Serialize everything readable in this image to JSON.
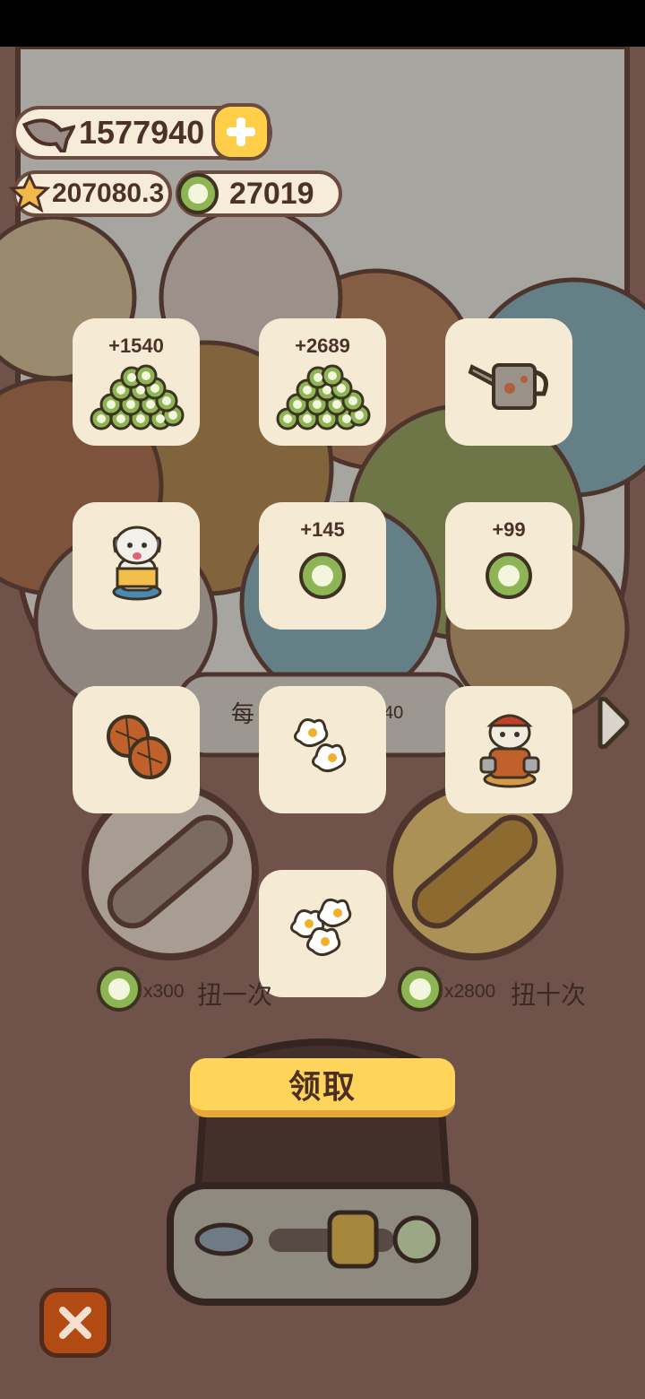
{
  "currency": {
    "fish": "1577940",
    "stars": "207080.3",
    "coins": "27019"
  },
  "rewards": [
    {
      "amount": "+1540",
      "item": "coin-pile"
    },
    {
      "amount": "+2689",
      "item": "coin-pile"
    },
    {
      "amount": "",
      "item": "watering-can"
    },
    {
      "amount": "",
      "item": "dog-reading"
    },
    {
      "amount": "+145",
      "item": "coin"
    },
    {
      "amount": "+99",
      "item": "coin"
    },
    {
      "amount": "",
      "item": "brown-balls"
    },
    {
      "amount": "",
      "item": "fried-eggs"
    },
    {
      "amount": "",
      "item": "dog-plumber"
    },
    {
      "amount": "",
      "item": "fried-eggs"
    }
  ],
  "machine": {
    "info_prefix": "每",
    "info_suffix": "40",
    "spin_one_cost": "x300",
    "spin_one_label": "扭一次",
    "spin_ten_cost": "x2800",
    "spin_ten_label": "扭十次"
  },
  "buttons": {
    "claim": "领取"
  },
  "colors": {
    "card_bg": "#f5ead3",
    "claim_button": "#ffd45a",
    "close_button": "#b24a14",
    "coin_green": "#8db553"
  }
}
